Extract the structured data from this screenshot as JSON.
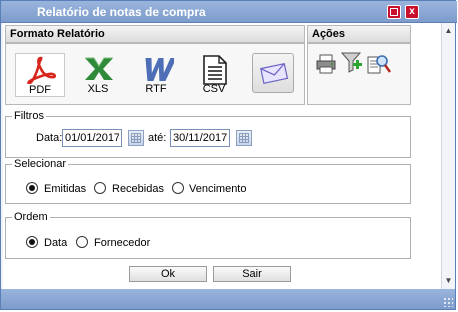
{
  "window": {
    "title": "Relatório de notas de compra"
  },
  "export": {
    "header": "Formato Relatório",
    "items": [
      {
        "label": "PDF",
        "icon": "pdf-icon"
      },
      {
        "label": "XLS",
        "icon": "xls-icon"
      },
      {
        "label": "RTF",
        "icon": "rtf-icon"
      },
      {
        "label": "CSV",
        "icon": "csv-icon"
      }
    ],
    "email_icon": "email-icon"
  },
  "actions": {
    "header": "Ações",
    "icons": [
      "print-icon",
      "add-filter-icon",
      "search-report-icon"
    ]
  },
  "filtros": {
    "legend": "Filtros",
    "date_label": "Data:",
    "start": "01/01/2017",
    "sep_label": "até:",
    "end": "30/11/2017"
  },
  "selecionar": {
    "legend": "Selecionar",
    "options": [
      "Emitidas",
      "Recebidas",
      "Vencimento"
    ],
    "selected": "Emitidas"
  },
  "ordem": {
    "legend": "Ordem",
    "options": [
      "Data",
      "Fornecedor"
    ],
    "selected": "Data"
  },
  "buttons": {
    "ok": "Ok",
    "exit": "Sair"
  },
  "colors": {
    "titlebar": "#8aa6d4",
    "pdf_red": "#d9261c",
    "xls_green": "#2f8a3a",
    "rtf_blue": "#4e6fb7"
  }
}
